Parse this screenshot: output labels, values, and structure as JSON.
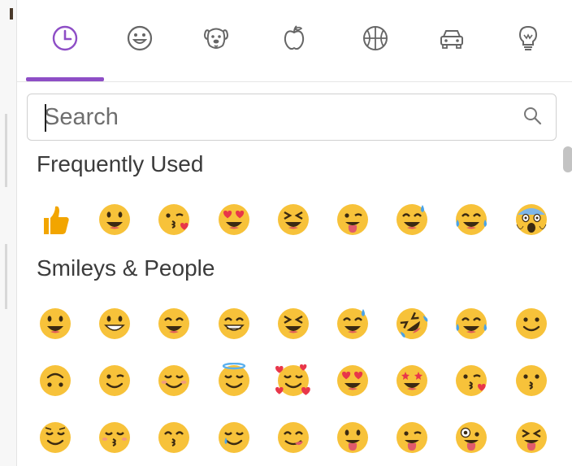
{
  "tabs": [
    {
      "icon": "clock-icon",
      "active": true
    },
    {
      "icon": "smiley-icon",
      "active": false
    },
    {
      "icon": "dog-icon",
      "active": false
    },
    {
      "icon": "apple-icon",
      "active": false
    },
    {
      "icon": "basketball-icon",
      "active": false
    },
    {
      "icon": "car-icon",
      "active": false
    },
    {
      "icon": "lightbulb-icon",
      "active": false
    }
  ],
  "colors": {
    "accent": "#8e4ec6",
    "emoji_face": "#f7c23a",
    "thumb": "#f2a500",
    "heart": "#e8364a"
  },
  "search": {
    "placeholder": "Search",
    "value": ""
  },
  "sections": {
    "frequent": {
      "title": "Frequently Used",
      "emojis": [
        "thumbs-up",
        "grinning-face",
        "kissing-face-heart",
        "heart-eyes",
        "laughing-closed-eyes",
        "tongue-wink",
        "sweat-smile",
        "tears-of-joy",
        "screaming-face"
      ]
    },
    "smileys": {
      "title": "Smileys & People",
      "rows": [
        [
          "grinning-face",
          "grinning-big-eyes",
          "grinning-smile-eyes",
          "beaming-face",
          "laughing-closed-eyes",
          "sweat-smile",
          "rofl",
          "tears-of-joy",
          "slight-smile"
        ],
        [
          "upside-down-face",
          "winking-face",
          "smiling-blush",
          "halo-face",
          "smiling-hearts",
          "heart-eyes",
          "star-struck",
          "kissing-face-heart",
          "kissing-face"
        ],
        [
          "relaxed-face",
          "kissing-closed-eyes",
          "kissing-smile-eyes",
          "smile-tear",
          "yum-face",
          "tongue-face",
          "tongue-wink",
          "zany-face",
          "squint-tongue"
        ]
      ]
    }
  }
}
